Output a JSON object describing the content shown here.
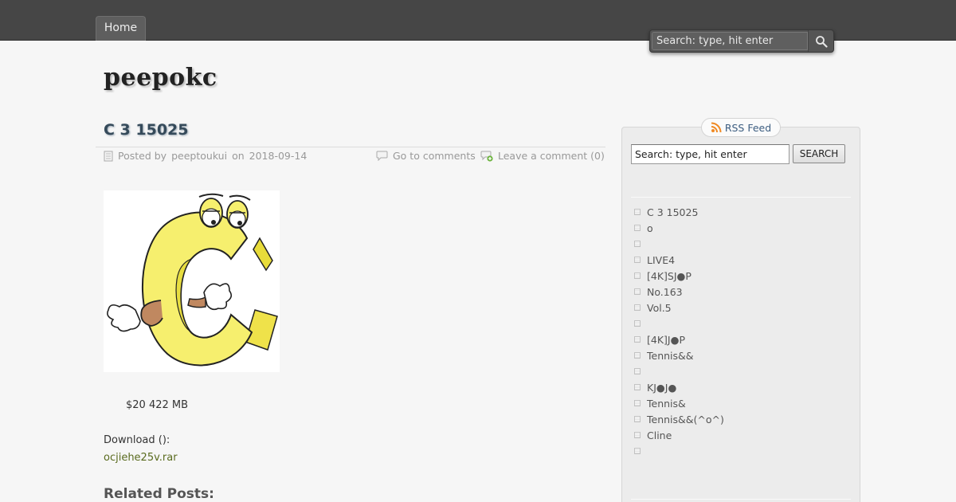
{
  "nav": {
    "home_label": "Home"
  },
  "top_search": {
    "placeholder": "Search: type, hit enter"
  },
  "site": {
    "title": "peepokc"
  },
  "post": {
    "title": "C 3 15025",
    "meta": {
      "posted_by_prefix": "Posted by",
      "author": "peeptoukui",
      "on_word": "on",
      "date": "2018-09-14",
      "go_to_comments": "Go to comments",
      "leave_comment": "Leave a comment (0)"
    },
    "price_line": "$20 422 MB",
    "download_label": "Download ():",
    "download_file": "ocjiehe25v.rar",
    "related_heading": "Related Posts:"
  },
  "sidebar": {
    "rss_label": "RSS Feed",
    "search_placeholder": "Search: type, hit enter",
    "search_button": "SEARCH",
    "recent_posts": [
      "C 3 15025",
      "o",
      "",
      "LIVE4",
      "[4K]SJ●P",
      " No.163",
      "Vol.5",
      "",
      "[4K]J●P",
      "Tennis&&",
      "",
      "KJ●J●",
      "Tennis&",
      "Tennis&&(^o^)",
      "Cline",
      ""
    ]
  },
  "colors": {
    "topbar": "#464646",
    "link_green": "#5a6b1f",
    "rss_blue": "#3c5d80",
    "rss_orange": "#f08a24",
    "illustration_yellow": "#f6ef6e"
  },
  "icons": {
    "search": "magnifier-icon",
    "post_meta": "document-icon",
    "comments": "speech-bubble-icon",
    "leave_comment": "comment-add-icon",
    "rss": "rss-icon"
  }
}
